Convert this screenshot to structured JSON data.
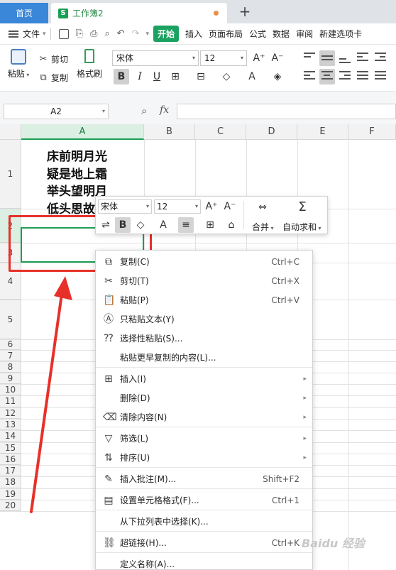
{
  "tabs": {
    "home": "首页",
    "workbook": "工作簿2",
    "workbook_logo": "S",
    "new_tab": "+"
  },
  "menu": {
    "file": "文件",
    "start": "开始",
    "items": [
      "插入",
      "页面布局",
      "公式",
      "数据",
      "审阅",
      "新建选项卡"
    ]
  },
  "ribbon": {
    "paste": "粘贴",
    "cut": "剪切",
    "copy": "复制",
    "format_painter": "格式刷",
    "font_name": "宋体",
    "font_size": "12",
    "bold": "B",
    "italic": "I",
    "underline": "U"
  },
  "formula_bar": {
    "name_box": "A2",
    "fx": "fx"
  },
  "grid": {
    "columns": [
      "A",
      "B",
      "C",
      "D",
      "E",
      "F"
    ],
    "active_column": "A",
    "rows": [
      "1",
      "2",
      "3",
      "4",
      "5",
      "6",
      "7",
      "8",
      "9",
      "10",
      "11",
      "12",
      "13",
      "14",
      "15",
      "16",
      "17",
      "18",
      "19",
      "20"
    ],
    "active_row": "2",
    "poem": [
      "床前明月光",
      "疑是地上霜",
      "举头望明月",
      "低头思故乡"
    ]
  },
  "mini_toolbar": {
    "font_name": "宋体",
    "font_size": "12",
    "bold": "B",
    "merge": "合并",
    "autosum": "自动求和"
  },
  "context_menu": {
    "items": [
      {
        "icon": "copy-icon",
        "label": "复制(C)",
        "shortcut": "Ctrl+C",
        "sub": false
      },
      {
        "icon": "scissors-icon",
        "label": "剪切(T)",
        "shortcut": "Ctrl+X",
        "sub": false
      },
      {
        "icon": "paste-icon",
        "label": "粘贴(P)",
        "shortcut": "Ctrl+V",
        "sub": false
      },
      {
        "icon": "paste-text-icon",
        "label": "只粘贴文本(Y)",
        "shortcut": "",
        "sub": false
      },
      {
        "icon": "paste-special-icon",
        "label": "选择性粘贴(S)...",
        "shortcut": "",
        "sub": false
      },
      {
        "icon": "",
        "label": "粘贴更早复制的内容(L)...",
        "shortcut": "",
        "sub": false
      },
      {
        "icon": "insert-icon",
        "label": "插入(I)",
        "shortcut": "",
        "sub": true
      },
      {
        "icon": "",
        "label": "删除(D)",
        "shortcut": "",
        "sub": true
      },
      {
        "icon": "clear-icon",
        "label": "清除内容(N)",
        "shortcut": "",
        "sub": true
      },
      {
        "icon": "filter-icon",
        "label": "筛选(L)",
        "shortcut": "",
        "sub": true
      },
      {
        "icon": "sort-icon",
        "label": "排序(U)",
        "shortcut": "",
        "sub": true
      },
      {
        "icon": "comment-icon",
        "label": "插入批注(M)...",
        "shortcut": "Shift+F2",
        "sub": false
      },
      {
        "icon": "format-cells-icon",
        "label": "设置单元格格式(F)...",
        "shortcut": "Ctrl+1",
        "sub": false
      },
      {
        "icon": "",
        "label": "从下拉列表中选择(K)...",
        "shortcut": "",
        "sub": false
      },
      {
        "icon": "link-icon",
        "label": "超链接(H)...",
        "shortcut": "Ctrl+K",
        "sub": false
      },
      {
        "icon": "",
        "label": "定义名称(A)...",
        "shortcut": "",
        "sub": false
      }
    ]
  },
  "watermark": "Baidu 经验",
  "colors": {
    "accent": "#1c9e56",
    "annotation": "#e8302a",
    "home_tab": "#3a86d8"
  }
}
